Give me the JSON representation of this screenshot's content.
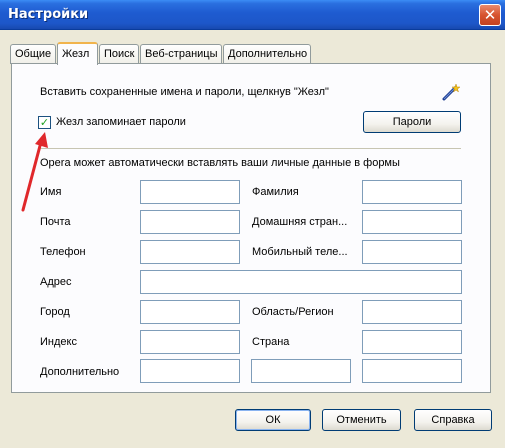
{
  "window": {
    "title": "Настройки",
    "close_glyph": "✕"
  },
  "tabs": [
    {
      "label": "Общие"
    },
    {
      "label": "Жезл",
      "active": true
    },
    {
      "label": "Поиск"
    },
    {
      "label": "Веб-страницы"
    },
    {
      "label": "Дополнительно"
    }
  ],
  "wand": {
    "insert_hint": "Вставить сохраненные имена и пароли, щелкнув \"Жезл\"",
    "icon": "wand-icon",
    "remember_checkbox": {
      "label": "Жезл запоминает пароли",
      "checked": true
    },
    "passwords_button": "Пароли"
  },
  "form": {
    "description": "Opera может автоматически вставлять ваши личные данные в формы",
    "fields": {
      "first_name": {
        "label": "Имя",
        "value": ""
      },
      "last_name": {
        "label": "Фамилия",
        "value": ""
      },
      "email": {
        "label": "Почта",
        "value": ""
      },
      "home_page": {
        "label": "Домашняя стран...",
        "value": ""
      },
      "phone": {
        "label": "Телефон",
        "value": ""
      },
      "mobile": {
        "label": "Мобильный теле...",
        "value": ""
      },
      "address": {
        "label": "Адрес",
        "value": ""
      },
      "city": {
        "label": "Город",
        "value": ""
      },
      "region": {
        "label": "Область/Регион",
        "value": ""
      },
      "zip": {
        "label": "Индекс",
        "value": ""
      },
      "country": {
        "label": "Страна",
        "value": ""
      },
      "extra": {
        "label": "Дополнительно",
        "value": ""
      }
    }
  },
  "footer": {
    "ok": "ОК",
    "cancel": "Отменить",
    "help": "Справка"
  },
  "annotation": {
    "arrow_color": "#e0282b"
  },
  "colors": {
    "titlebar": "#1e5bd0",
    "active_tab_accent": "#f1b44c",
    "dialog_bg": "#ece9d8"
  }
}
